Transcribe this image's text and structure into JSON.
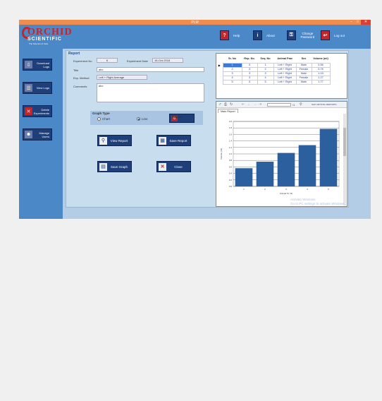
{
  "window": {
    "title": "PLM"
  },
  "logo": {
    "brand": "ORCHID",
    "sub": "SCIENTIFIC",
    "tagline": "The Science of Care"
  },
  "header": {
    "help_label": "Help",
    "about_label": "About",
    "change_password_label": "Change Password",
    "logout_label": "Log out"
  },
  "sidebar": {
    "items": [
      {
        "label": "Download Logs"
      },
      {
        "label": "View Logs"
      },
      {
        "label": "Delete Experiments"
      },
      {
        "label": "Manage Users"
      }
    ]
  },
  "report": {
    "title": "Report",
    "exp_no_label": "Experiment No",
    "exp_no_value": "6",
    "exp_date_label": "Experiment Date",
    "exp_date_value": "18-Oct-2018",
    "title_label": "Title",
    "title_value": "abc",
    "exp_method_label": "Exp. Method",
    "exp_method_value": "Left + Right Average",
    "comments_label": "Comments",
    "comments_value": "abc"
  },
  "graph_type": {
    "label": "Graph Type",
    "options": [
      "Chart",
      "Line"
    ],
    "selected": "Line",
    "replot_label": "Replot"
  },
  "actions": {
    "view_report_label": "View Report",
    "save_report_label": "Save Report",
    "save_graph_label": "Save Graph",
    "close_label": "Close"
  },
  "table": {
    "columns": [
      "Sr. No",
      "Rep. No.",
      "Seq. No",
      "Animal Paw",
      "Sex",
      "Volume (ml)"
    ],
    "rows": [
      [
        "1",
        "3",
        "1",
        "Left + Right",
        "Male",
        "0.56"
      ],
      [
        "2",
        "3",
        "2",
        "Left + Right",
        "Female",
        "0.76"
      ],
      [
        "3",
        "3",
        "3",
        "Left + Right",
        "Male",
        "1.03"
      ],
      [
        "4",
        "3",
        "4",
        "Left + Right",
        "Female",
        "1.27"
      ],
      [
        "5",
        "3",
        "5",
        "Left + Right",
        "Male",
        "1.77"
      ]
    ],
    "selected_row": 0
  },
  "viewer": {
    "page_label": "/1",
    "tool_label": "SAP CRYSTAL REPORTS",
    "tab_label": "Main Report"
  },
  "chart_data": {
    "type": "bar",
    "categories": [
      "1",
      "2",
      "3",
      "4",
      "5"
    ],
    "values": [
      0.56,
      0.76,
      1.03,
      1.27,
      1.77
    ],
    "ylim": [
      0,
      2.0
    ],
    "yticks": [
      "0.0",
      "0.2",
      "0.4",
      "0.6",
      "0.8",
      "1.0",
      "1.2",
      "1.4",
      "1.6",
      "1.8",
      "2.0"
    ],
    "xlabel": "Animal Sr. No",
    "ylabel": "Volume (ml)",
    "grid": true,
    "bar_color": "#2b5f9e"
  },
  "watermark": {
    "line1": "Activate Windows",
    "line2": "Go to PC settings to activate Windows."
  }
}
